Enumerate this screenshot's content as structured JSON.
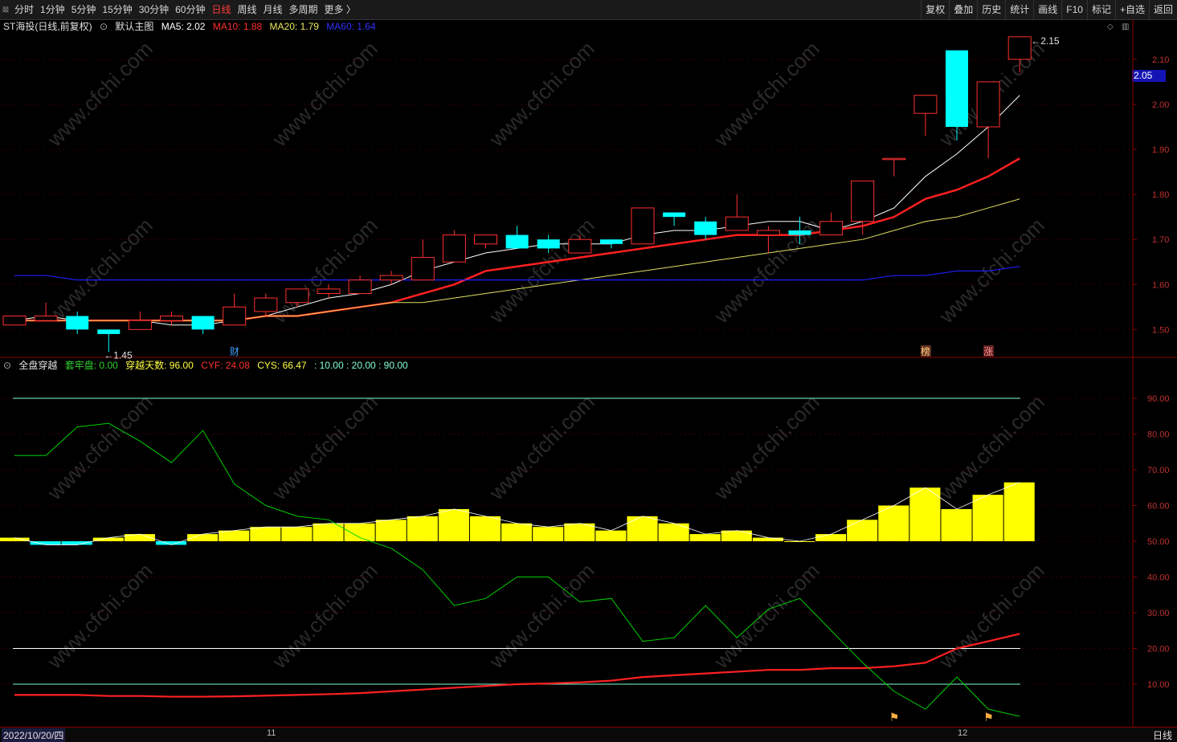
{
  "toolbar": {
    "periods": [
      "分时",
      "1分钟",
      "5分钟",
      "15分钟",
      "30分钟",
      "60分钟",
      "日线",
      "周线",
      "月线",
      "多周期",
      "更多 〉"
    ],
    "active_period": "日线",
    "right_buttons": [
      "复权",
      "叠加",
      "历史",
      "统计",
      "画线",
      "F10",
      "标记",
      "+自选",
      "返回"
    ]
  },
  "main_legend": {
    "stock": "ST海投(日线,前复权)",
    "template": "默认主图",
    "ma5": "MA5: 2.02",
    "ma10": "MA10: 1.88",
    "ma20": "MA20: 1.79",
    "ma60": "MA60: 1.64"
  },
  "indicator_legend": {
    "name": "全盘穿越",
    "lock": "套牢盘: 0.00",
    "cross_days": "穿越天数: 96.00",
    "cyf": "CYF: 24.08",
    "cys": "CYS: 66.47",
    "levels": ": 10.00   : 20.00   : 90.00"
  },
  "price_axis": [
    "2.10",
    "2.00",
    "1.90",
    "1.80",
    "1.70",
    "1.60",
    "1.50"
  ],
  "current_price": "2.05",
  "high_label": "2.15",
  "low_label": "1.45",
  "markers": {
    "finance": "财",
    "bang": "榜",
    "zhang": "涨"
  },
  "indicator_axis": [
    "90.00",
    "80.00",
    "70.00",
    "60.00",
    "50.00",
    "40.00",
    "30.00",
    "20.00",
    "10.00"
  ],
  "date_label": "2022/10/20/四",
  "month_labels": [
    "11",
    "12"
  ],
  "period_label": "日线",
  "watermark": "www.cfchi.com",
  "colors": {
    "up": "#ff3030",
    "down": "#00ffff",
    "ma5": "#ffffff",
    "ma10": "#ff2020",
    "ma20": "#e0e060",
    "ma60": "#2020ff",
    "yellow_bar": "#ffff00",
    "cyan_bar": "#00ffff",
    "green_line": "#00d000",
    "cyf_line": "#ff2020",
    "ref_line_cyan": "#80ffd0",
    "ref_line_white": "#ffffff"
  },
  "chart_data": [
    {
      "type": "candlestick",
      "title": "ST海投(日线,前复权)",
      "ylim": [
        1.44,
        2.18
      ],
      "candles": [
        {
          "o": 1.51,
          "c": 1.53,
          "h": 1.53,
          "l": 1.51
        },
        {
          "o": 1.52,
          "c": 1.53,
          "h": 1.56,
          "l": 1.52
        },
        {
          "o": 1.53,
          "c": 1.5,
          "h": 1.54,
          "l": 1.49
        },
        {
          "o": 1.5,
          "c": 1.49,
          "h": 1.5,
          "l": 1.45
        },
        {
          "o": 1.5,
          "c": 1.52,
          "h": 1.54,
          "l": 1.5
        },
        {
          "o": 1.52,
          "c": 1.53,
          "h": 1.54,
          "l": 1.51
        },
        {
          "o": 1.53,
          "c": 1.5,
          "h": 1.53,
          "l": 1.49
        },
        {
          "o": 1.51,
          "c": 1.55,
          "h": 1.58,
          "l": 1.51
        },
        {
          "o": 1.54,
          "c": 1.57,
          "h": 1.58,
          "l": 1.53
        },
        {
          "o": 1.56,
          "c": 1.59,
          "h": 1.59,
          "l": 1.55
        },
        {
          "o": 1.58,
          "c": 1.59,
          "h": 1.6,
          "l": 1.57
        },
        {
          "o": 1.58,
          "c": 1.61,
          "h": 1.62,
          "l": 1.58
        },
        {
          "o": 1.61,
          "c": 1.62,
          "h": 1.63,
          "l": 1.6
        },
        {
          "o": 1.61,
          "c": 1.66,
          "h": 1.7,
          "l": 1.61
        },
        {
          "o": 1.65,
          "c": 1.71,
          "h": 1.72,
          "l": 1.65
        },
        {
          "o": 1.69,
          "c": 1.71,
          "h": 1.71,
          "l": 1.68
        },
        {
          "o": 1.71,
          "c": 1.68,
          "h": 1.73,
          "l": 1.68
        },
        {
          "o": 1.7,
          "c": 1.68,
          "h": 1.71,
          "l": 1.67
        },
        {
          "o": 1.67,
          "c": 1.7,
          "h": 1.71,
          "l": 1.67
        },
        {
          "o": 1.7,
          "c": 1.69,
          "h": 1.7,
          "l": 1.68
        },
        {
          "o": 1.69,
          "c": 1.77,
          "h": 1.77,
          "l": 1.69
        },
        {
          "o": 1.76,
          "c": 1.75,
          "h": 1.76,
          "l": 1.73
        },
        {
          "o": 1.74,
          "c": 1.71,
          "h": 1.75,
          "l": 1.7
        },
        {
          "o": 1.72,
          "c": 1.75,
          "h": 1.8,
          "l": 1.72
        },
        {
          "o": 1.71,
          "c": 1.72,
          "h": 1.73,
          "l": 1.67
        },
        {
          "o": 1.72,
          "c": 1.71,
          "h": 1.75,
          "l": 1.69
        },
        {
          "o": 1.71,
          "c": 1.74,
          "h": 1.76,
          "l": 1.71
        },
        {
          "o": 1.74,
          "c": 1.83,
          "h": 1.83,
          "l": 1.71
        },
        {
          "o": 1.88,
          "c": 1.88,
          "h": 1.88,
          "l": 1.84
        },
        {
          "o": 1.98,
          "c": 2.02,
          "h": 2.02,
          "l": 1.93
        },
        {
          "o": 2.12,
          "c": 1.95,
          "h": 2.12,
          "l": 1.92
        },
        {
          "o": 1.95,
          "c": 2.05,
          "h": 2.05,
          "l": 1.88
        },
        {
          "o": 2.1,
          "c": 2.15,
          "h": 2.15,
          "l": 2.07
        }
      ],
      "series": [
        {
          "name": "MA5",
          "values": [
            1.52,
            1.53,
            1.52,
            1.52,
            1.52,
            1.51,
            1.51,
            1.52,
            1.53,
            1.55,
            1.57,
            1.58,
            1.6,
            1.63,
            1.65,
            1.67,
            1.68,
            1.69,
            1.69,
            1.69,
            1.71,
            1.72,
            1.72,
            1.73,
            1.74,
            1.74,
            1.72,
            1.74,
            1.77,
            1.84,
            1.89,
            1.95,
            2.02
          ]
        },
        {
          "name": "MA10",
          "values": [
            1.52,
            1.52,
            1.52,
            1.52,
            1.52,
            1.52,
            1.52,
            1.52,
            1.53,
            1.53,
            1.54,
            1.55,
            1.56,
            1.58,
            1.6,
            1.63,
            1.64,
            1.65,
            1.66,
            1.67,
            1.68,
            1.69,
            1.7,
            1.71,
            1.71,
            1.71,
            1.72,
            1.73,
            1.75,
            1.79,
            1.81,
            1.84,
            1.88
          ]
        },
        {
          "name": "MA20",
          "values": [
            1.52,
            1.52,
            1.52,
            1.52,
            1.52,
            1.52,
            1.52,
            1.52,
            1.53,
            1.53,
            1.54,
            1.55,
            1.56,
            1.56,
            1.57,
            1.58,
            1.59,
            1.6,
            1.61,
            1.62,
            1.63,
            1.64,
            1.65,
            1.66,
            1.67,
            1.68,
            1.69,
            1.7,
            1.72,
            1.74,
            1.75,
            1.77,
            1.79
          ]
        },
        {
          "name": "MA60",
          "values": [
            1.62,
            1.62,
            1.61,
            1.61,
            1.61,
            1.61,
            1.61,
            1.61,
            1.61,
            1.61,
            1.61,
            1.61,
            1.61,
            1.61,
            1.61,
            1.61,
            1.61,
            1.61,
            1.61,
            1.61,
            1.61,
            1.61,
            1.61,
            1.61,
            1.61,
            1.61,
            1.61,
            1.61,
            1.62,
            1.62,
            1.63,
            1.63,
            1.64
          ]
        }
      ]
    },
    {
      "type": "bar",
      "title": "全盘穿越",
      "ylim": [
        0,
        100
      ],
      "baseline": 50,
      "series": [
        {
          "name": "CYS",
          "values": [
            51,
            49,
            49,
            51,
            52,
            49,
            52,
            53,
            54,
            54,
            55,
            55,
            56,
            57,
            59,
            57,
            55,
            54,
            55,
            53,
            57,
            55,
            52,
            53,
            51,
            50,
            52,
            56,
            60,
            65,
            59,
            63,
            66.47
          ]
        },
        {
          "name": "CYF",
          "values": [
            7,
            7,
            7,
            6.7,
            6.7,
            6.5,
            6.5,
            6.6,
            6.8,
            7,
            7.2,
            7.5,
            8,
            8.5,
            9,
            9.5,
            10,
            10.2,
            10.5,
            11,
            12,
            12.5,
            13,
            13.5,
            14,
            14,
            14.5,
            14.5,
            15,
            16,
            20,
            22,
            24.08
          ]
        },
        {
          "name": "穿越天数",
          "values": [
            74,
            74,
            82,
            83,
            78,
            72,
            81,
            66,
            60,
            57,
            56,
            51,
            48,
            42,
            32,
            34,
            40,
            40,
            33,
            34,
            22,
            23,
            32,
            23,
            31,
            34,
            25,
            16,
            8,
            3,
            12,
            3,
            1
          ]
        }
      ],
      "reference_lines": [
        10,
        20,
        90
      ]
    }
  ]
}
